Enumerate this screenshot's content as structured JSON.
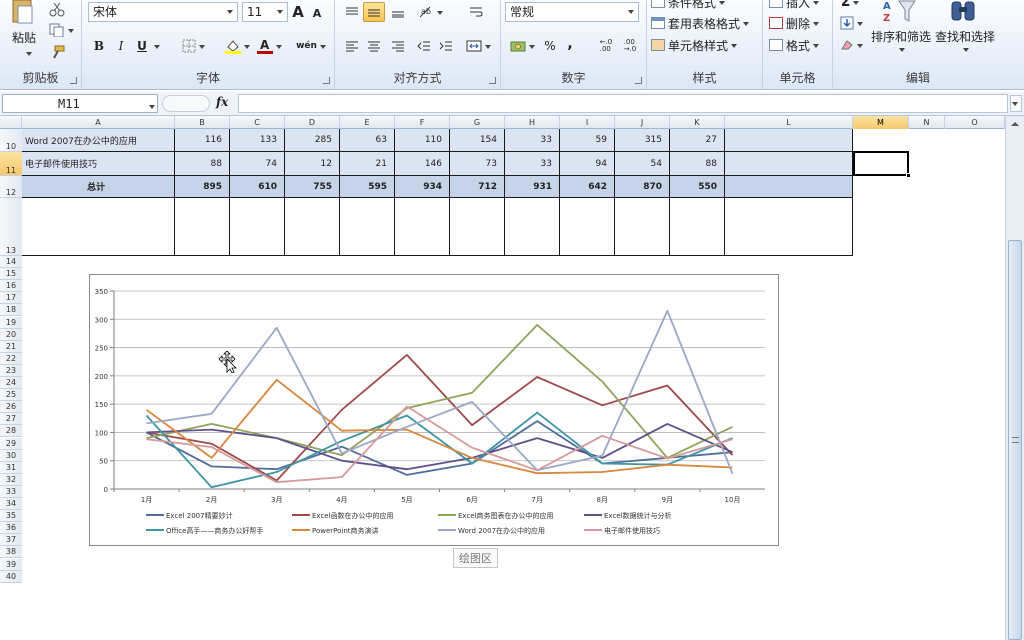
{
  "ribbon": {
    "clipboard": {
      "paste_label": "粘贴",
      "group_label": "剪贴板"
    },
    "font": {
      "name": "宋体",
      "size": "11",
      "bold": "B",
      "italic": "I",
      "underline": "U",
      "grow": "A",
      "shrink": "A",
      "wen": "wén",
      "group_label": "字体"
    },
    "alignment": {
      "group_label": "对齐方式"
    },
    "number": {
      "format": "常规",
      "percent": "%",
      "comma": ",",
      "group_label": "数字"
    },
    "styles": {
      "conditional": "条件格式",
      "table_format": "套用表格格式",
      "cell_styles": "单元格样式",
      "group_label": "样式"
    },
    "cells": {
      "insert": "插入",
      "delete": "删除",
      "format": "格式",
      "group_label": "单元格"
    },
    "editing": {
      "sort_filter": "排序和筛选",
      "find_select": "查找和选择",
      "group_label": "编辑",
      "sigma": "Σ"
    }
  },
  "formula_bar": {
    "name_box": "M11",
    "fx": "fx",
    "formula": ""
  },
  "sheet": {
    "columns": [
      "A",
      "B",
      "C",
      "D",
      "E",
      "F",
      "G",
      "H",
      "I",
      "J",
      "K",
      "L",
      "M",
      "N",
      "O"
    ],
    "selected_column": "M",
    "selected_row": "11",
    "rows": [
      {
        "row": "10",
        "label": "Word 2007在办公中的应用",
        "values": [
          "116",
          "133",
          "285",
          "63",
          "110",
          "154",
          "33",
          "59",
          "315",
          "27"
        ]
      },
      {
        "row": "11",
        "label": "电子邮件使用技巧",
        "values": [
          "88",
          "74",
          "12",
          "21",
          "146",
          "73",
          "33",
          "94",
          "54",
          "88"
        ]
      },
      {
        "row": "12",
        "label": "总计",
        "values": [
          "895",
          "610",
          "755",
          "595",
          "934",
          "712",
          "931",
          "642",
          "870",
          "550"
        ]
      }
    ],
    "blank_rows": [
      "13",
      "14",
      "15",
      "16",
      "17",
      "18",
      "19",
      "20",
      "21",
      "22",
      "23",
      "24",
      "25",
      "26",
      "27",
      "28",
      "29",
      "30",
      "31",
      "32",
      "33",
      "34",
      "35",
      "36",
      "37",
      "38",
      "39",
      "40"
    ]
  },
  "plot_area_label": "绘图区",
  "chart_data": {
    "type": "line",
    "categories": [
      "1月",
      "2月",
      "3月",
      "4月",
      "5月",
      "6月",
      "7月",
      "8月",
      "9月",
      "10月"
    ],
    "ylim": [
      0,
      350
    ],
    "yticks": [
      "0",
      "50",
      "100",
      "150",
      "200",
      "250",
      "300",
      "350"
    ],
    "grid": true,
    "legend_position": "bottom",
    "series": [
      {
        "name": "Excel 2007精要妙计",
        "color": "#4f6d9e",
        "values": [
          100,
          40,
          35,
          75,
          25,
          45,
          120,
          45,
          55,
          65
        ]
      },
      {
        "name": "Excel函数在办公中的应用",
        "color": "#9e4a4a",
        "values": [
          100,
          80,
          15,
          140,
          237,
          113,
          198,
          148,
          183,
          60
        ]
      },
      {
        "name": "Excel商务图表在办公中的应用",
        "color": "#8fa35a",
        "values": [
          90,
          115,
          90,
          60,
          143,
          170,
          290,
          190,
          55,
          110
        ]
      },
      {
        "name": "Excel数据统计与分析",
        "color": "#5f4f8a",
        "values": [
          100,
          105,
          90,
          50,
          35,
          55,
          90,
          55,
          115,
          65
        ]
      },
      {
        "name": "Office高手——商务办公好帮手",
        "color": "#3d95a6",
        "values": [
          130,
          3,
          30,
          85,
          130,
          45,
          135,
          45,
          43,
          90
        ]
      },
      {
        "name": "PowerPoint商务演讲",
        "color": "#d9873d",
        "values": [
          140,
          55,
          193,
          103,
          105,
          55,
          28,
          30,
          43,
          38
        ]
      },
      {
        "name": "Word 2007在办公中的应用",
        "color": "#9aa8c6",
        "values": [
          116,
          133,
          285,
          63,
          110,
          154,
          33,
          59,
          315,
          27
        ]
      },
      {
        "name": "电子邮件使用技巧",
        "color": "#d69a9a",
        "values": [
          88,
          74,
          12,
          21,
          146,
          73,
          33,
          94,
          54,
          88
        ]
      }
    ]
  }
}
